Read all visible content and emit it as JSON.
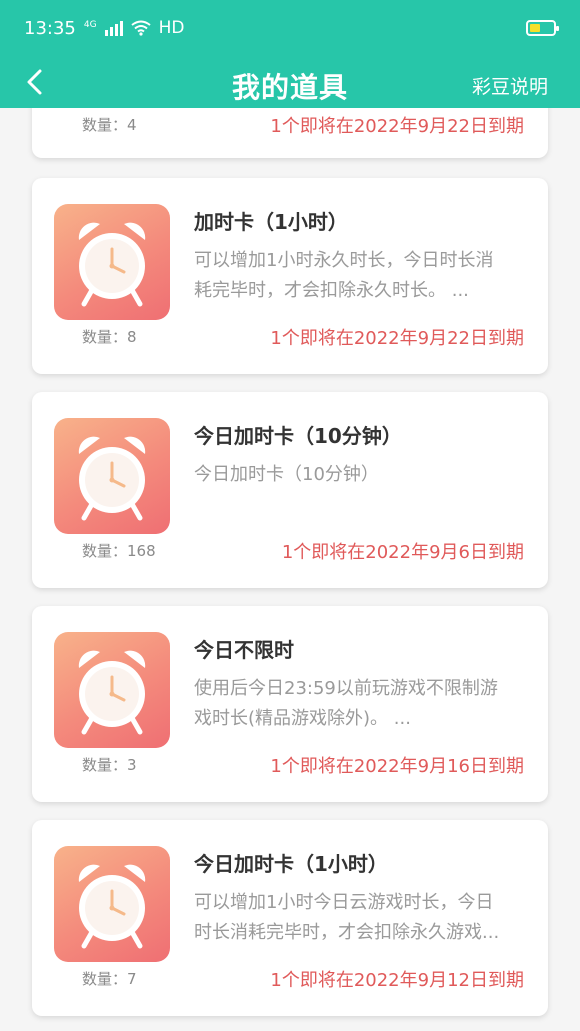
{
  "status_bar": {
    "time": "13:35",
    "network": "4G",
    "hd": "HD",
    "icons": [
      "signal-icon",
      "wifi-icon",
      "battery-icon"
    ]
  },
  "nav": {
    "title": "我的道具",
    "action": "彩豆说明",
    "back_icon": "chevron-left-icon",
    "background": "#27c6a9"
  },
  "partial_card": {
    "quantity": "数量：4",
    "expire": "1个即将在2022年9月22日到期"
  },
  "items": [
    {
      "title": "加时卡（1小时）",
      "desc_line1": "可以增加1小时永久时长，今日时长消",
      "desc_line2": "耗完毕时，才会扣除永久时长。 ...",
      "quantity": "数量：8",
      "expire": "1个即将在2022年9月22日到期",
      "icon": "alarm-clock-icon"
    },
    {
      "title": "今日加时卡（10分钟）",
      "desc_line1": "今日加时卡（10分钟）",
      "desc_line2": "",
      "quantity": "数量：168",
      "expire": "1个即将在2022年9月6日到期",
      "icon": "alarm-clock-icon"
    },
    {
      "title": "今日不限时",
      "desc_line1": "使用后今日23:59以前玩游戏不限制游",
      "desc_line2": "戏时长(精品游戏除外)。 ...",
      "quantity": "数量：3",
      "expire": "1个即将在2022年9月16日到期",
      "icon": "alarm-clock-icon"
    },
    {
      "title": "今日加时卡（1小时）",
      "desc_line1": "可以增加1小时今日云游戏时长，今日",
      "desc_line2": "时长消耗完毕时，才会扣除永久游戏...",
      "quantity": "数量：7",
      "expire": "1个即将在2022年9月12日到期",
      "icon": "alarm-clock-icon"
    }
  ],
  "colors": {
    "accent": "#27c6a9",
    "expire_text": "#e05a5a",
    "muted_text": "#9a9a9a"
  }
}
